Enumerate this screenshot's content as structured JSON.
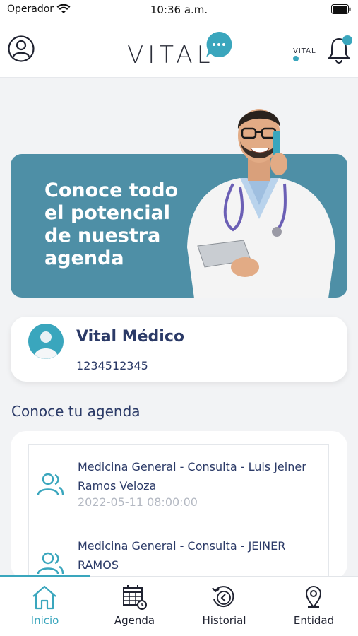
{
  "status_bar": {
    "carrier": "Operador",
    "time": "10:36 a.m."
  },
  "header": {
    "brand": "VITAL",
    "mini_brand": "VITAL",
    "profile_icon": "user-circle-icon",
    "notification_icon": "bell-icon",
    "notification_dot_color": "#3aa6bd"
  },
  "banner": {
    "title": "Conoce todo el potencial de nuestra agenda",
    "background_color": "#4e8fa6"
  },
  "profile": {
    "name": "Vital Médico",
    "id": "1234512345"
  },
  "agenda": {
    "section_title": "Conoce tu agenda",
    "items": [
      {
        "title": "Medicina General - Consulta - Luis Jeiner Ramos Veloza",
        "date": "2022-05-11 08:00:00",
        "icon": "users-icon"
      },
      {
        "title": "Medicina General - Consulta - JEINER RAMOS",
        "date": "",
        "icon": "users-icon"
      }
    ]
  },
  "tabs": [
    {
      "label": "Inicio",
      "icon": "home-icon",
      "active": true
    },
    {
      "label": "Agenda",
      "icon": "calendar-icon",
      "active": false
    },
    {
      "label": "Historial",
      "icon": "history-icon",
      "active": false
    },
    {
      "label": "Entidad",
      "icon": "location-pin-icon",
      "active": false
    }
  ],
  "colors": {
    "accent": "#3aa6bd",
    "text_primary": "#2b3a67",
    "text_muted": "#b3b8c2"
  }
}
